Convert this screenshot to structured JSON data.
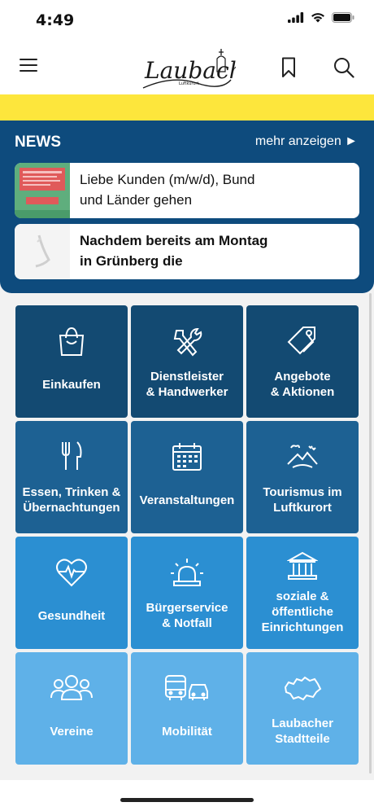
{
  "status": {
    "time": "4:49"
  },
  "news": {
    "title": "NEWS",
    "more": "mehr anzeigen ►",
    "items": [
      {
        "text_line1": "Liebe Kunden (m/w/d), Bund",
        "text_line2": "und Länder gehen"
      },
      {
        "text_line1": "Nachdem bereits am Montag",
        "text_line2": "in Grünberg  die"
      }
    ]
  },
  "tiles": [
    {
      "line1": "Einkaufen",
      "line2": "",
      "icon": "shopping-bag-icon",
      "color": "#134a72"
    },
    {
      "line1": "Dienstleister",
      "line2": "& Handwerker",
      "icon": "tools-icon",
      "color": "#134a72"
    },
    {
      "line1": "Angebote",
      "line2": "& Aktionen",
      "icon": "tag-icon",
      "color": "#134a72"
    },
    {
      "line1": "Essen, Trinken &",
      "line2": "Übernachtungen",
      "icon": "cutlery-icon",
      "color": "#1d6193"
    },
    {
      "line1": "Veranstaltungen",
      "line2": "",
      "icon": "calendar-icon",
      "color": "#1d6193"
    },
    {
      "line1": "Tourismus im",
      "line2": "Luftkurort",
      "icon": "landscape-icon",
      "color": "#1d6193"
    },
    {
      "line1": "Gesundheit",
      "line2": "",
      "icon": "heart-icon",
      "color": "#2b8fd2"
    },
    {
      "line1": "Bürgerservice",
      "line2": "& Notfall",
      "icon": "siren-icon",
      "color": "#2b8fd2"
    },
    {
      "line1": "soziale &",
      "line2": "öffentliche",
      "line3": "Einrichtungen",
      "icon": "building-icon",
      "color": "#2b8fd2"
    },
    {
      "line1": "Vereine",
      "line2": "",
      "icon": "group-icon",
      "color": "#5fb1e8"
    },
    {
      "line1": "Mobilität",
      "line2": "",
      "icon": "vehicles-icon",
      "color": "#5fb1e8"
    },
    {
      "line1": "Laubacher",
      "line2": "Stadtteile",
      "icon": "map-icon",
      "color": "#5fb1e8"
    }
  ]
}
